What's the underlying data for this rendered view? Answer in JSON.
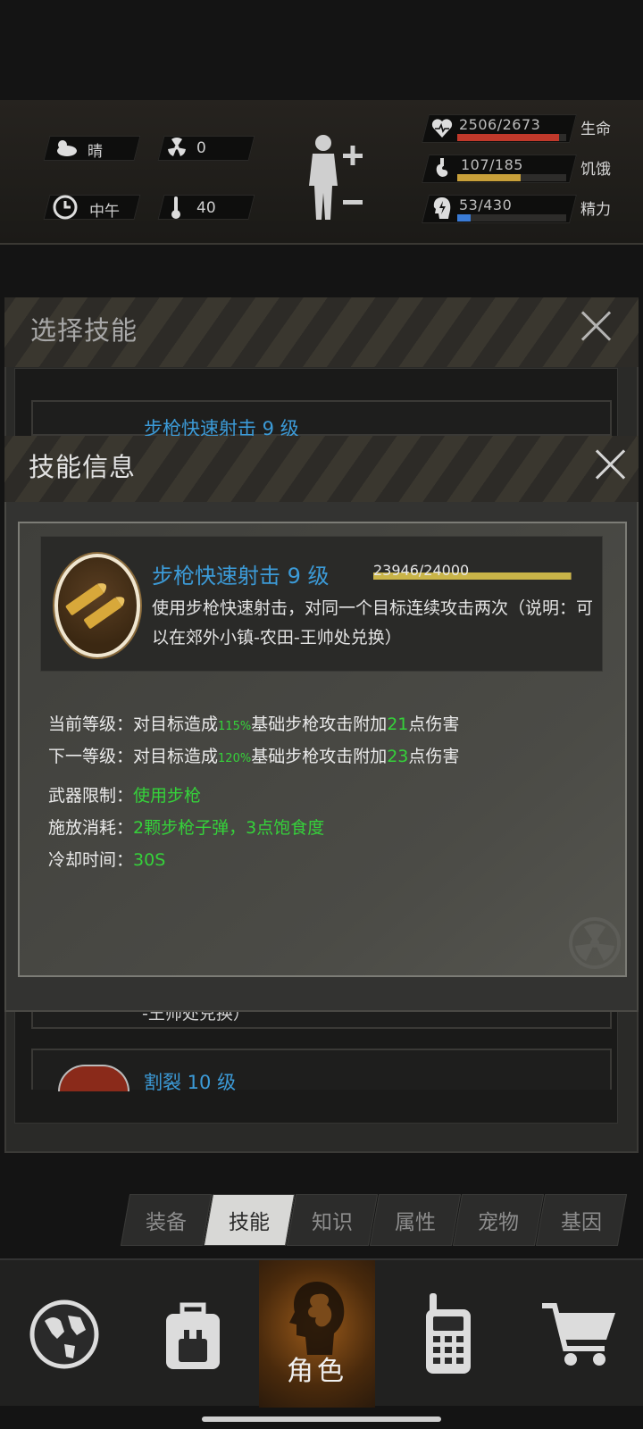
{
  "status": {
    "weather": "晴",
    "radiation": "0",
    "time_of_day": "中午",
    "temperature": "40",
    "vitals": [
      {
        "value": "2506/2673",
        "label": "生命",
        "fill": 0.937,
        "color": "#c0392b"
      },
      {
        "value": "107/185",
        "label": "饥饿",
        "fill": 0.578,
        "color": "#c8a03a"
      },
      {
        "value": "53/430",
        "label": "精力",
        "fill": 0.123,
        "color": "#3a7bd5"
      }
    ]
  },
  "background_dialog": {
    "title": "选择技能",
    "items": [
      {
        "text": "步枪快速射击 9 级"
      },
      {
        "text": "-王帅处兑换）"
      },
      {
        "text": "割裂 10 级"
      }
    ]
  },
  "dialog": {
    "title": "技能信息",
    "skill": {
      "name": "步枪快速射击 9 级",
      "xp": "23946/24000",
      "xp_fraction": 0.9977,
      "description": "使用步枪快速射击，对同一个目标连续攻击两次（说明：可以在郊外小镇-农田-王帅处兑换）",
      "icon": "rifle-bullets-icon"
    },
    "current_level": {
      "label": "当前等级：",
      "pre": "对目标造成",
      "pct": "115%",
      "mid": "基础步枪攻击附加",
      "dmg": "21",
      "post": "点伤害"
    },
    "next_level": {
      "label": "下一等级：",
      "pre": "对目标造成",
      "pct": "120%",
      "mid": "基础步枪攻击附加",
      "dmg": "23",
      "post": "点伤害"
    },
    "weapon_limit": {
      "label": "武器限制：",
      "value": "使用步枪"
    },
    "cost": {
      "label": "施放消耗：",
      "value": "2颗步枪子弹，3点饱食度"
    },
    "cooldown": {
      "label": "冷却时间：",
      "value": "30S"
    }
  },
  "tabs": [
    {
      "label": "装备",
      "active": false
    },
    {
      "label": "技能",
      "active": true
    },
    {
      "label": "知识",
      "active": false
    },
    {
      "label": "属性",
      "active": false
    },
    {
      "label": "宠物",
      "active": false
    },
    {
      "label": "基因",
      "active": false
    }
  ],
  "nav": {
    "items": [
      {
        "icon": "globe-icon"
      },
      {
        "icon": "backpack-icon"
      },
      {
        "icon": "character-head-icon",
        "label": "角色",
        "active": true
      },
      {
        "icon": "radio-icon"
      },
      {
        "icon": "cart-icon"
      }
    ]
  }
}
